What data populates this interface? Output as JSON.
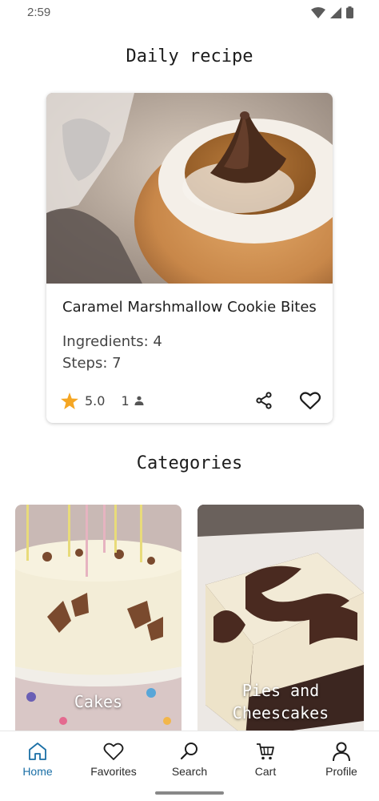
{
  "status_bar": {
    "time": "2:59",
    "icons": [
      "wifi-icon",
      "signal-icon",
      "battery-icon"
    ]
  },
  "daily_section": {
    "title": "Daily recipe"
  },
  "daily_recipe": {
    "name": "Caramel Marshmallow Cookie Bites",
    "ingredients_label": "Ingredients: 4",
    "steps_label": "Steps: 7",
    "rating": "5.0",
    "reviews": "1",
    "image": "cookie-cup-photo"
  },
  "categories_section": {
    "title": "Categories"
  },
  "categories": [
    {
      "label": "Cakes",
      "image": "cake-photo"
    },
    {
      "label_line1": "Pies and",
      "label_line2": "Cheescakes",
      "image": "brownie-cheesecake-photo"
    }
  ],
  "bottom_nav": {
    "items": [
      {
        "label": "Home",
        "icon": "home-icon",
        "active": true
      },
      {
        "label": "Favorites",
        "icon": "heart-icon"
      },
      {
        "label": "Search",
        "icon": "search-icon"
      },
      {
        "label": "Cart",
        "icon": "cart-icon"
      },
      {
        "label": "Profile",
        "icon": "person-icon"
      }
    ]
  },
  "colors": {
    "accent": "#1a6fa6",
    "star": "#f5a623",
    "text": "#1c1c1c"
  }
}
